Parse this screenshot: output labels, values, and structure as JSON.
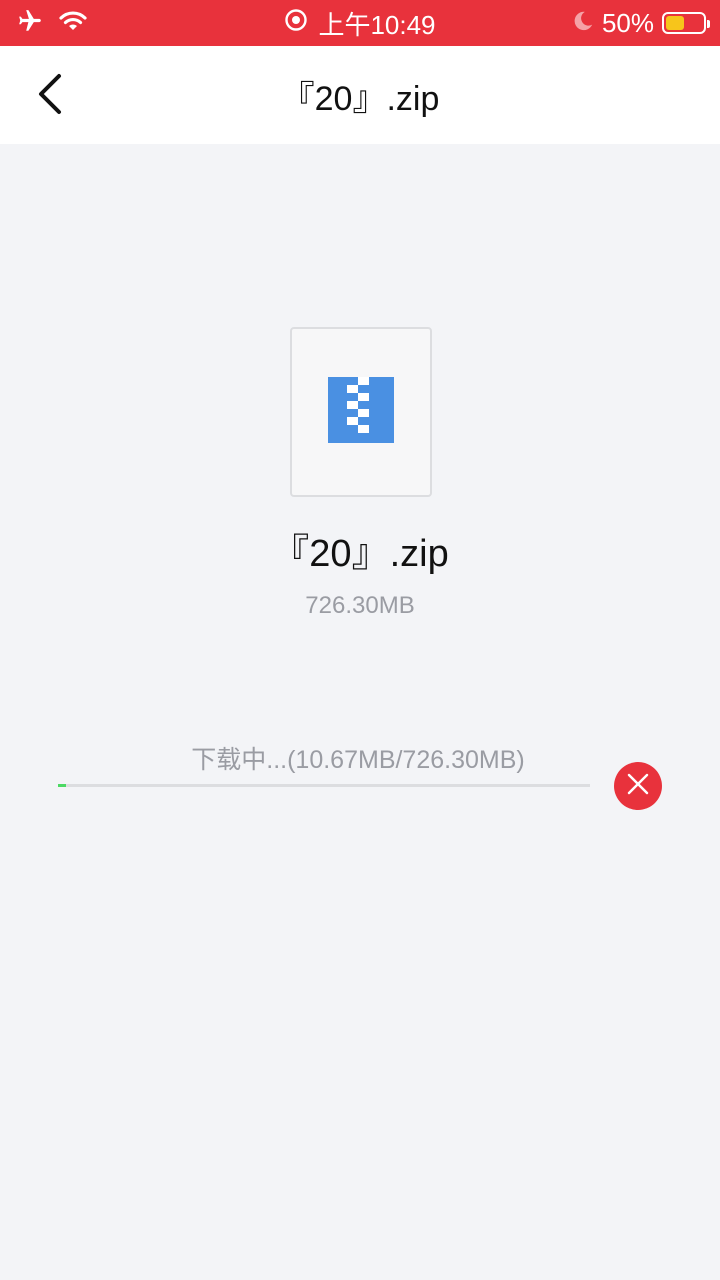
{
  "status_bar": {
    "time": "上午10:49",
    "battery_percent": "50%",
    "battery_level": 0.5,
    "icons": [
      "airplane-icon",
      "wifi-icon",
      "orientation-lock-icon",
      "moon-icon",
      "battery-icon"
    ]
  },
  "nav": {
    "title": "『20』.zip",
    "back_icon": "chevron-left-icon"
  },
  "file": {
    "icon": "zip-file-icon",
    "name": "『20』.zip",
    "size": "726.30MB"
  },
  "download": {
    "status_text": "下载中...(10.67MB/726.30MB)",
    "progress_fraction": 0.0147,
    "cancel_icon": "close-icon"
  },
  "colors": {
    "accent": "#e8323c",
    "progress": "#4cd964",
    "zip_icon": "#4a90e2",
    "background": "#f3f4f7"
  }
}
